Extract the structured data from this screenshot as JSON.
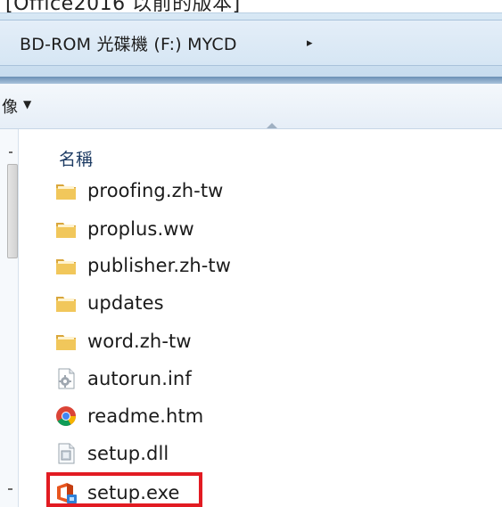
{
  "caption": {
    "text": "[Office2016 以前的版本]"
  },
  "address_bar": {
    "path": "BD-ROM 光碟機 (F:) MYCD",
    "arrow": "▸"
  },
  "toolbar": {
    "label": "像",
    "arrow": "▼"
  },
  "file_list": {
    "column_name": "名稱",
    "items": [
      {
        "name": "proofing.zh-tw",
        "icon": "folder-icon"
      },
      {
        "name": "proplus.ww",
        "icon": "folder-icon"
      },
      {
        "name": "publisher.zh-tw",
        "icon": "folder-icon"
      },
      {
        "name": "updates",
        "icon": "folder-icon"
      },
      {
        "name": "word.zh-tw",
        "icon": "folder-icon"
      },
      {
        "name": "autorun.inf",
        "icon": "settings-file-icon"
      },
      {
        "name": "readme.htm",
        "icon": "browser-file-icon"
      },
      {
        "name": "setup.dll",
        "icon": "dll-file-icon"
      },
      {
        "name": "setup.exe",
        "icon": "office-setup-icon"
      }
    ]
  },
  "colors": {
    "highlight": "#e21b22",
    "folder": "#e8b84a",
    "address_band": "#cfe1f1"
  }
}
